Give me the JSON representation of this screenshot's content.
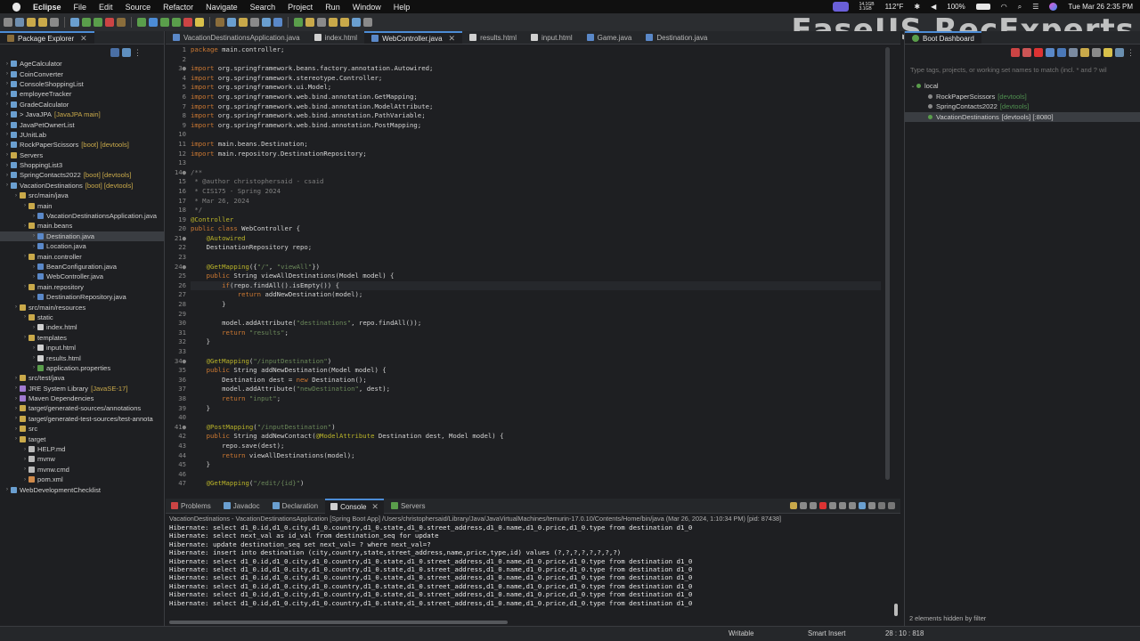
{
  "menubar": {
    "app": "Eclipse",
    "items": [
      "File",
      "Edit",
      "Source",
      "Refactor",
      "Navigate",
      "Search",
      "Project",
      "Run",
      "Window",
      "Help"
    ],
    "stats_top": "14.1GB",
    "stats_bottom": "3.1GB",
    "temperature": "112°F",
    "battery": "100%",
    "datetime": "Tue Mar 26  2:35 PM"
  },
  "watermark": "EaseUS RecExperts",
  "package_explorer": {
    "title": "Package Explorer",
    "items": [
      {
        "label": "AgeCalculator",
        "indent": 0,
        "deco": "",
        "icon": "project-icon"
      },
      {
        "label": "CoinConverter",
        "indent": 0,
        "deco": "",
        "icon": "project-icon"
      },
      {
        "label": "ConsoleShoppingList",
        "indent": 0,
        "deco": "",
        "icon": "project-icon"
      },
      {
        "label": "employeeTracker",
        "indent": 0,
        "deco": "",
        "icon": "project-icon"
      },
      {
        "label": "GradeCalculator",
        "indent": 0,
        "deco": "",
        "icon": "project-icon"
      },
      {
        "label": "> JavaJPA",
        "indent": 0,
        "deco": "[JavaJPA main]",
        "icon": "project-icon"
      },
      {
        "label": "JavaPetOwnerList",
        "indent": 0,
        "deco": "",
        "icon": "project-icon"
      },
      {
        "label": "JUnitLab",
        "indent": 0,
        "deco": "",
        "icon": "project-icon"
      },
      {
        "label": "RockPaperScissors",
        "indent": 0,
        "deco": "[boot] [devtools]",
        "icon": "project-icon"
      },
      {
        "label": "Servers",
        "indent": 0,
        "deco": "",
        "icon": "folder-icon"
      },
      {
        "label": "ShoppingList3",
        "indent": 0,
        "deco": "",
        "icon": "project-icon"
      },
      {
        "label": "SpringContacts2022",
        "indent": 0,
        "deco": "[boot] [devtools]",
        "icon": "project-icon"
      },
      {
        "label": "VacationDestinations",
        "indent": 0,
        "deco": "[boot] [devtools]",
        "icon": "project-icon"
      },
      {
        "label": "src/main/java",
        "indent": 1,
        "deco": "",
        "icon": "source-folder-icon"
      },
      {
        "label": "main",
        "indent": 2,
        "deco": "",
        "icon": "package-icon"
      },
      {
        "label": "VacationDestinationsApplication.java",
        "indent": 3,
        "deco": "",
        "icon": "java-file-icon"
      },
      {
        "label": "main.beans",
        "indent": 2,
        "deco": "",
        "icon": "package-icon"
      },
      {
        "label": "Destination.java",
        "indent": 3,
        "deco": "",
        "icon": "java-file-icon"
      },
      {
        "label": "Location.java",
        "indent": 3,
        "deco": "",
        "icon": "java-file-icon"
      },
      {
        "label": "main.controller",
        "indent": 2,
        "deco": "",
        "icon": "package-icon"
      },
      {
        "label": "BeanConfiguration.java",
        "indent": 3,
        "deco": "",
        "icon": "java-file-icon"
      },
      {
        "label": "WebController.java",
        "indent": 3,
        "deco": "",
        "icon": "java-file-icon"
      },
      {
        "label": "main.repository",
        "indent": 2,
        "deco": "",
        "icon": "package-icon"
      },
      {
        "label": "DestinationRepository.java",
        "indent": 3,
        "deco": "",
        "icon": "java-file-icon"
      },
      {
        "label": "src/main/resources",
        "indent": 1,
        "deco": "",
        "icon": "source-folder-icon"
      },
      {
        "label": "static",
        "indent": 2,
        "deco": "",
        "icon": "folder-icon"
      },
      {
        "label": "index.html",
        "indent": 3,
        "deco": "",
        "icon": "html-file-icon"
      },
      {
        "label": "templates",
        "indent": 2,
        "deco": "",
        "icon": "folder-icon"
      },
      {
        "label": "input.html",
        "indent": 3,
        "deco": "",
        "icon": "html-file-icon"
      },
      {
        "label": "results.html",
        "indent": 3,
        "deco": "",
        "icon": "html-file-icon"
      },
      {
        "label": "application.properties",
        "indent": 3,
        "deco": "",
        "icon": "properties-file-icon"
      },
      {
        "label": "src/test/java",
        "indent": 1,
        "deco": "",
        "icon": "source-folder-icon"
      },
      {
        "label": "JRE System Library",
        "indent": 1,
        "deco": "[JavaSE-17]",
        "icon": "library-icon"
      },
      {
        "label": "Maven Dependencies",
        "indent": 1,
        "deco": "",
        "icon": "library-icon"
      },
      {
        "label": "target/generated-sources/annotations",
        "indent": 1,
        "deco": "",
        "icon": "source-folder-icon"
      },
      {
        "label": "target/generated-test-sources/test-annota",
        "indent": 1,
        "deco": "",
        "icon": "source-folder-icon"
      },
      {
        "label": "src",
        "indent": 1,
        "deco": "",
        "icon": "folder-icon"
      },
      {
        "label": "target",
        "indent": 1,
        "deco": "",
        "icon": "folder-icon"
      },
      {
        "label": "HELP.md",
        "indent": 2,
        "deco": "",
        "icon": "text-file-icon"
      },
      {
        "label": "mvnw",
        "indent": 2,
        "deco": "",
        "icon": "text-file-icon"
      },
      {
        "label": "mvnw.cmd",
        "indent": 2,
        "deco": "",
        "icon": "text-file-icon"
      },
      {
        "label": "pom.xml",
        "indent": 2,
        "deco": "",
        "icon": "xml-file-icon"
      },
      {
        "label": "WebDevelopmentChecklist",
        "indent": 0,
        "deco": "",
        "icon": "project-icon"
      }
    ],
    "selected_index": 17
  },
  "editor": {
    "tabs": [
      "VacationDestinationsApplication.java",
      "index.html",
      "WebController.java",
      "results.html",
      "input.html",
      "Game.java",
      "Destination.java"
    ],
    "active_tab": 2,
    "line_numbers": [
      "1",
      "2",
      "3●",
      "4",
      "5",
      "6",
      "7",
      "8",
      "9",
      "10",
      "11",
      "12",
      "13",
      "14●",
      "15",
      "16",
      "17",
      "18",
      "19",
      "20",
      "21●",
      "22",
      "23",
      "24●",
      "25",
      "26",
      "27",
      "28",
      "29",
      "30",
      "31",
      "32",
      "33",
      "34●",
      "35",
      "36",
      "37",
      "38",
      "39",
      "40",
      "41●",
      "42",
      "43",
      "44",
      "45",
      "46",
      "47"
    ],
    "lines": [
      "package main.controller;",
      "",
      "import org.springframework.beans.factory.annotation.Autowired;",
      "import org.springframework.stereotype.Controller;",
      "import org.springframework.ui.Model;",
      "import org.springframework.web.bind.annotation.GetMapping;",
      "import org.springframework.web.bind.annotation.ModelAttribute;",
      "import org.springframework.web.bind.annotation.PathVariable;",
      "import org.springframework.web.bind.annotation.PostMapping;",
      "",
      "import main.beans.Destination;",
      "import main.repository.DestinationRepository;",
      "",
      "/**",
      " * @author christophersaid - csaid",
      " * CIS175 - Spring 2024",
      " * Mar 26, 2024",
      " */",
      "@Controller",
      "public class WebController {",
      "    @Autowired",
      "    DestinationRepository repo;",
      "",
      "    @GetMapping({\"/\", \"viewAll\"})",
      "    public String viewAllDestinations(Model model) {",
      "        if(repo.findAll().isEmpty()) {",
      "            return addNewDestination(model);",
      "        }",
      "",
      "        model.addAttribute(\"destinations\", repo.findAll());",
      "        return \"results\";",
      "    }",
      "",
      "    @GetMapping(\"/inputDestination\")",
      "    public String addNewDestination(Model model) {",
      "        Destination dest = new Destination();",
      "        model.addAttribute(\"newDestination\", dest);",
      "        return \"input\";",
      "    }",
      "",
      "    @PostMapping(\"/inputDestination\")",
      "    public String addNewContact(@ModelAttribute Destination dest, Model model) {",
      "        repo.save(dest);",
      "        return viewAllDestinations(model);",
      "    }",
      "",
      "    @GetMapping(\"/edit/{id}\")"
    ],
    "current_line_index": 25
  },
  "console": {
    "tabs": [
      "Problems",
      "Javadoc",
      "Declaration",
      "Console",
      "Servers"
    ],
    "active_tab": 3,
    "launch_info": "VacationDestinations - VacationDestinationsApplication [Spring Boot App] /Users/christophersaid/Library/Java/JavaVirtualMachines/temurin-17.0.10/Contents/Home/bin/java  (Mar 26, 2024, 1:10:34 PM) [pid: 87438]",
    "lines": [
      "Hibernate: select d1_0.id,d1_0.city,d1_0.country,d1_0.state,d1_0.street_address,d1_0.name,d1_0.price,d1_0.type from destination d1_0",
      "Hibernate: select next_val as id_val from destination_seq for update",
      "Hibernate: update destination_seq set next_val= ? where next_val=?",
      "Hibernate: insert into destination (city,country,state,street_address,name,price,type,id) values (?,?,?,?,?,?,?,?)",
      "Hibernate: select d1_0.id,d1_0.city,d1_0.country,d1_0.state,d1_0.street_address,d1_0.name,d1_0.price,d1_0.type from destination d1_0",
      "Hibernate: select d1_0.id,d1_0.city,d1_0.country,d1_0.state,d1_0.street_address,d1_0.name,d1_0.price,d1_0.type from destination d1_0",
      "Hibernate: select d1_0.id,d1_0.city,d1_0.country,d1_0.state,d1_0.street_address,d1_0.name,d1_0.price,d1_0.type from destination d1_0",
      "Hibernate: select d1_0.id,d1_0.city,d1_0.country,d1_0.state,d1_0.street_address,d1_0.name,d1_0.price,d1_0.type from destination d1_0",
      "Hibernate: select d1_0.id,d1_0.city,d1_0.country,d1_0.state,d1_0.street_address,d1_0.name,d1_0.price,d1_0.type from destination d1_0",
      "Hibernate: select d1_0.id,d1_0.city,d1_0.country,d1_0.state,d1_0.street_address,d1_0.name,d1_0.price,d1_0.type from destination d1_0"
    ]
  },
  "boot_dashboard": {
    "title": "Boot Dashboard",
    "filter_placeholder": "Type tags, projects, or working set names to match (incl. * and ? wil",
    "group": "local",
    "apps": [
      {
        "name": "RockPaperScissors",
        "deco": "[devtools]"
      },
      {
        "name": "SpringContacts2022",
        "deco": "[devtools]"
      },
      {
        "name": "VacationDestinations",
        "deco": "[devtools] [:8080]"
      }
    ],
    "selected_index": 2,
    "footer": "2 elements hidden by filter"
  },
  "statusbar": {
    "writable": "Writable",
    "insert_mode": "Smart Insert",
    "position": "28 : 10 : 818"
  },
  "colors": {
    "keyword": "#cc7832",
    "annotation": "#bbb529",
    "string": "#6a8759",
    "comment": "#808080",
    "type": "#a9b7c6",
    "method": "#ffc66d",
    "accent": "#4c8cd6"
  }
}
